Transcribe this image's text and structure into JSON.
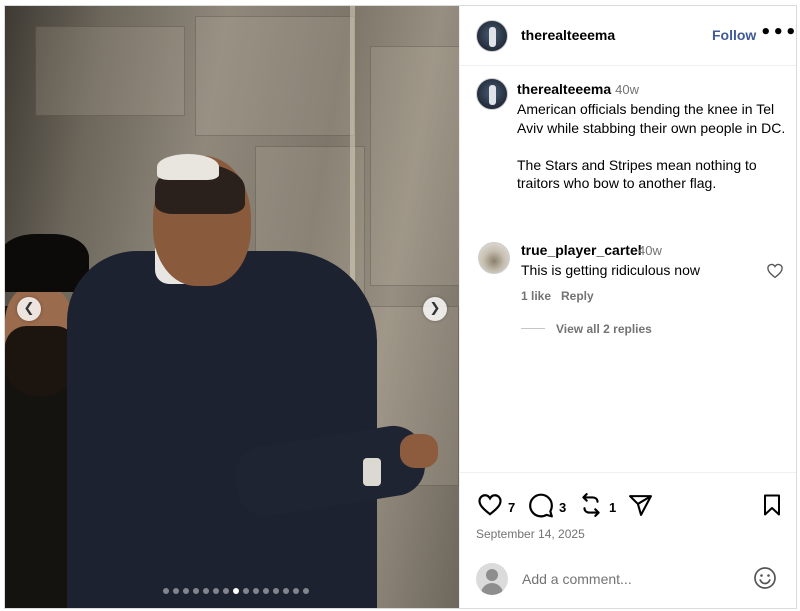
{
  "post": {
    "carousel": {
      "slide_count": 15,
      "active_index": 7,
      "prev_icon": "chevron-left-icon",
      "next_icon": "chevron-right-icon"
    }
  },
  "header": {
    "username": "therealteeema",
    "follow_label": "Follow",
    "more_icon": "•••"
  },
  "caption": {
    "username": "therealteeema",
    "time": "40w",
    "text": "American officials bending the knee in Tel Aviv while stabbing their own people in DC.\n\nThe Stars and Stripes mean nothing to traitors who bow to another flag."
  },
  "comments": [
    {
      "username": "true_player_cartel",
      "time": "40w",
      "text": "This is getting ridiculous now",
      "likes_label": "1 like",
      "reply_label": "Reply",
      "view_replies_label": "View all 2 replies"
    }
  ],
  "actions": {
    "like_count": "7",
    "comment_count": "3",
    "repost_count": "1",
    "date": "September 14, 2025"
  },
  "add_comment": {
    "placeholder": "Add a comment..."
  },
  "colors": {
    "follow": "#3f5a97",
    "secondary_text": "#737373",
    "border": "#dbdbdb"
  }
}
